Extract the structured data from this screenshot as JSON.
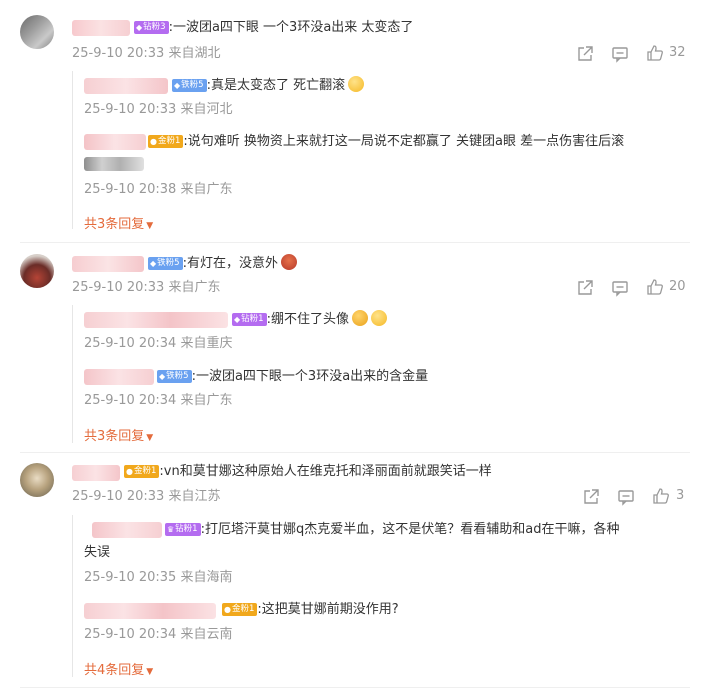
{
  "comments": [
    {
      "badge": {
        "label": "钻粉3",
        "color": "#b46cf0"
      },
      "text": ":一波团a四下眼  一个3环没a出来  太变态了",
      "meta": "25-9-10 20:33  来自湖北",
      "likes": "32",
      "replies": [
        {
          "badge": {
            "label": "铁粉5",
            "color": "#6aa1f0"
          },
          "text": ":真是太变态了   死亡翻滚",
          "meta": "25-9-10 20:33  来自河北"
        },
        {
          "badge": {
            "label": "金粉1",
            "color": "#f1a81c"
          },
          "text": ":说句难听  换物资上来就打这一局说不定都赢了  关键团a眼  差一点伤害往后滚",
          "meta": "25-9-10 20:38  来自广东"
        }
      ],
      "expand": "共3条回复"
    },
    {
      "badge": {
        "label": "铁粉5",
        "color": "#6aa1f0"
      },
      "text": ":有灯在，没意外",
      "meta": "25-9-10 20:33  来自广东",
      "likes": "20",
      "replies": [
        {
          "badge": {
            "label": "钻粉1",
            "color": "#b46cf0"
          },
          "text": ":绷不住了头像",
          "meta": "25-9-10 20:34  来自重庆"
        },
        {
          "badge": {
            "label": "铁粉5",
            "color": "#6aa1f0"
          },
          "text": ":一波团a四下眼一个3环没a出来的含金量",
          "meta": "25-9-10 20:34  来自广东"
        }
      ],
      "expand": "共3条回复"
    },
    {
      "badge": {
        "label": "金粉1",
        "color": "#f1a81c"
      },
      "text": ":vn和莫甘娜这种原始人在维克托和泽丽面前就跟笑话一样",
      "meta": "25-9-10 20:33  来自江苏",
      "likes": "3",
      "replies": [
        {
          "badge": {
            "label": "钻粉1",
            "color": "#b46cf0"
          },
          "text": ":打厄塔汗莫甘娜q杰克爱半血，这不是伏笔？看看辅助和ad在干嘛，各种",
          "text2": "失误",
          "meta": "25-9-10 20:35  来自海南"
        },
        {
          "badge": {
            "label": "金粉1",
            "color": "#f1a81c"
          },
          "text": ":这把莫甘娜前期没作用?",
          "meta": "25-9-10 20:34  来自云南"
        }
      ],
      "expand": "共4条回复"
    }
  ]
}
